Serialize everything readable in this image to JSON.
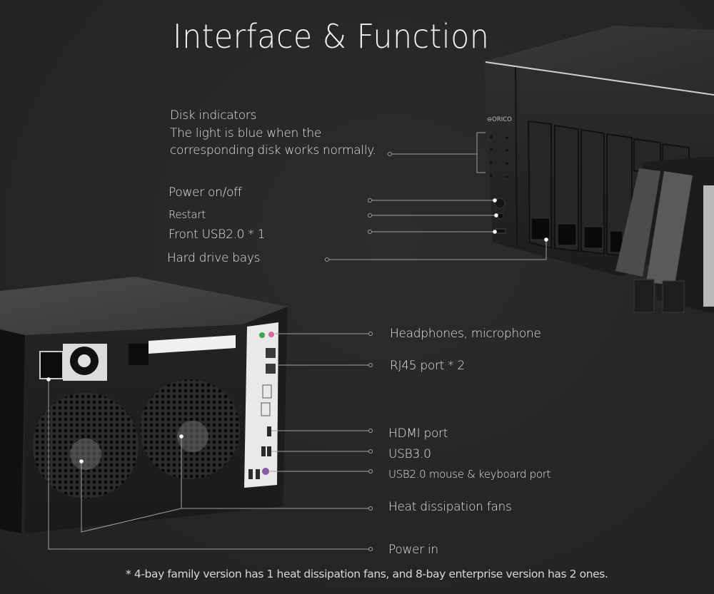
{
  "title": "Interface & Function",
  "front_callouts": {
    "disk_indicators": {
      "heading": "Disk indicators",
      "line1": "The light is blue when the",
      "line2": "corresponding disk works normally."
    },
    "power": "Power on/off",
    "restart": "Restart",
    "front_usb": "Front USB2.0 * 1",
    "drive_bays": "Hard drive bays"
  },
  "rear_callouts": {
    "audio": "Headphones, microphone",
    "rj45": "RJ45 port * 2",
    "hdmi": "HDMI port",
    "usb3": "USB3.0",
    "usb2": "USB2.0 mouse & keyboard port",
    "fans": "Heat dissipation fans",
    "power_in": "Power in"
  },
  "brand": "ORICO",
  "footnote": "* 4-bay family version has 1 heat dissipation fans, and 8-bay enterprise version has 2 ones.",
  "colors": {
    "background": "#262626",
    "text": "#e6e6e6",
    "leader_line": "#9a9a9a",
    "audio_green": "#3fa44a",
    "audio_pink": "#d76a9c",
    "ps2_purple": "#8a5aa6"
  }
}
